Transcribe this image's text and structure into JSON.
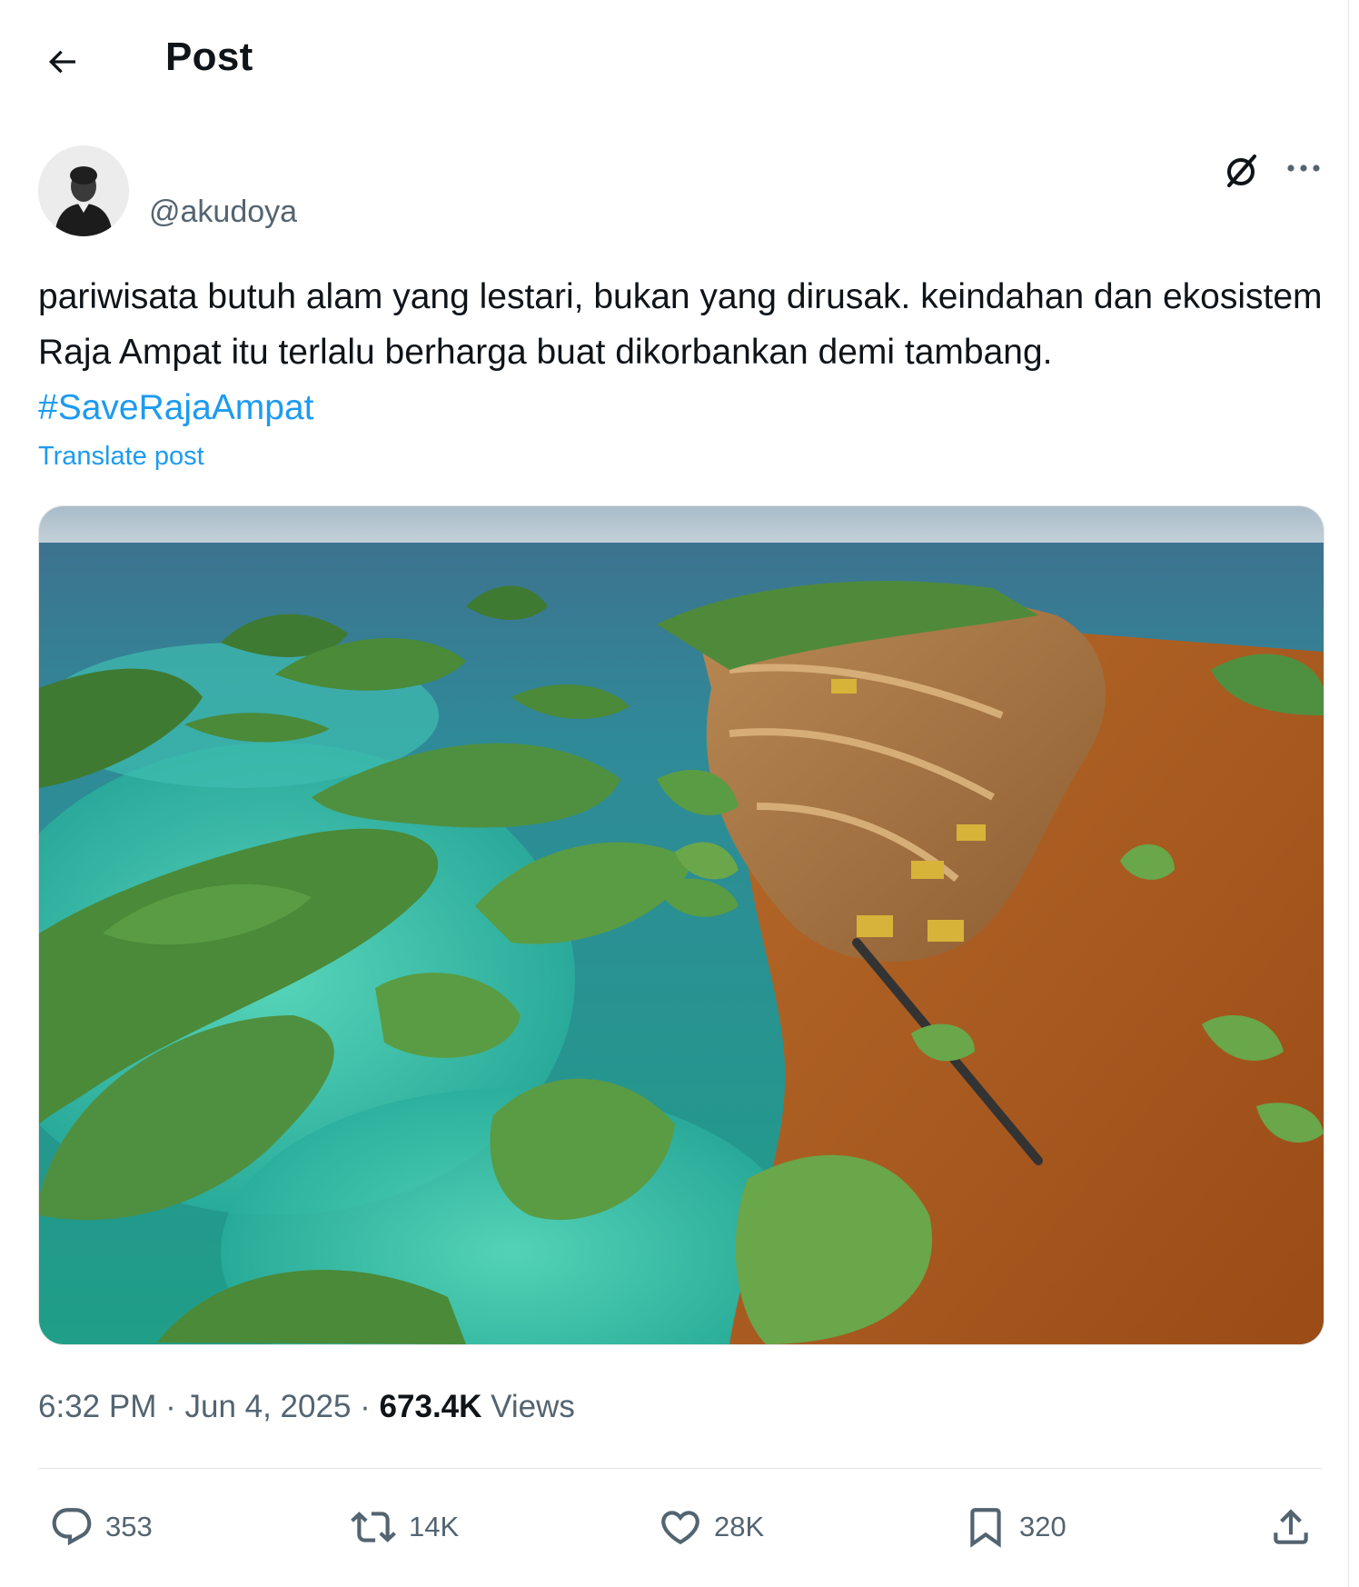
{
  "header": {
    "title": "Post"
  },
  "post": {
    "handle": "@akudoya",
    "text": "pariwisata butuh alam yang lestari, bukan yang dirusak. keindahan dan ekosistem Raja Ampat itu terlalu berharga buat dikorbankan demi tambang.",
    "hashtag": "#SaveRajaAmpat",
    "translate_label": "Translate post",
    "time": "6:32 PM",
    "separator": "·",
    "date": "Jun 4, 2025",
    "views_count": "673.4K",
    "views_label": "Views"
  },
  "actions": {
    "replies": "353",
    "reposts": "14K",
    "likes": "28K",
    "bookmarks": "320"
  },
  "icons": [
    "back-arrow-icon",
    "grok-icon",
    "more-icon",
    "reply-icon",
    "repost-icon",
    "like-icon",
    "bookmark-icon",
    "share-icon"
  ],
  "colors": {
    "accent": "#1d9bf0",
    "secondary_text": "#536471",
    "primary_text": "#0f1419"
  }
}
